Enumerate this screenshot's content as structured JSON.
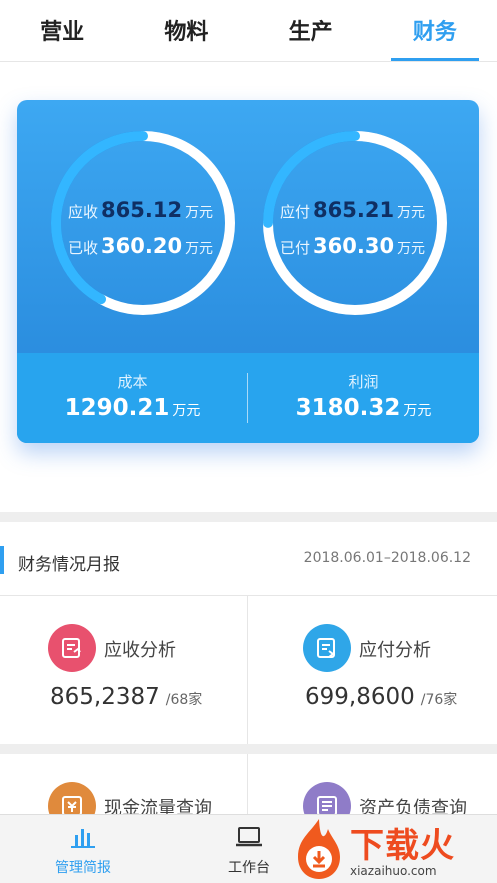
{
  "tabs": [
    {
      "label": "营业",
      "active": false
    },
    {
      "label": "物料",
      "active": false
    },
    {
      "label": "生产",
      "active": false
    },
    {
      "label": "财务",
      "active": true
    }
  ],
  "summary": {
    "receivable": {
      "due_label": "应收",
      "due_value": "865.12",
      "due_unit": "万元",
      "done_label": "已收",
      "done_value": "360.20",
      "done_unit": "万元",
      "progress": 0.42
    },
    "payable": {
      "due_label": "应付",
      "due_value": "865.21",
      "due_unit": "万元",
      "done_label": "已付",
      "done_value": "360.30",
      "done_unit": "万元",
      "progress": 0.25
    },
    "cost": {
      "label": "成本",
      "value": "1290.21",
      "unit": "万元"
    },
    "profit": {
      "label": "利润",
      "value": "3180.32",
      "unit": "万元"
    }
  },
  "report": {
    "title": "财务情况月报",
    "range": "2018.06.01–2018.06.12",
    "cells": [
      {
        "title": "应收分析",
        "value": "865,2387",
        "suffix": "/68家",
        "icon": "receivable-doc-icon",
        "color": "#e8516e"
      },
      {
        "title": "应付分析",
        "value": "699,8600",
        "suffix": "/76家",
        "icon": "payable-doc-icon",
        "color": "#2fa6e8"
      },
      {
        "title": "现金流量查询",
        "icon": "cashflow-doc-icon",
        "color": "#e08a3c"
      },
      {
        "title": "资产负债查询",
        "icon": "balance-doc-icon",
        "color": "#8f7cc8"
      }
    ]
  },
  "bottom_nav": [
    {
      "label": "管理简报",
      "icon": "bar-chart-icon",
      "active": true
    },
    {
      "label": "工作台",
      "icon": "laptop-icon",
      "active": false
    }
  ],
  "watermark": {
    "text": "下载火",
    "sub": "xiazaihuo.com"
  },
  "colors": {
    "accent": "#2f9ff0",
    "card_top": "#3da8f2",
    "card_bottom_bar": "#28a4ee",
    "value_dark": "#0f2f63"
  }
}
